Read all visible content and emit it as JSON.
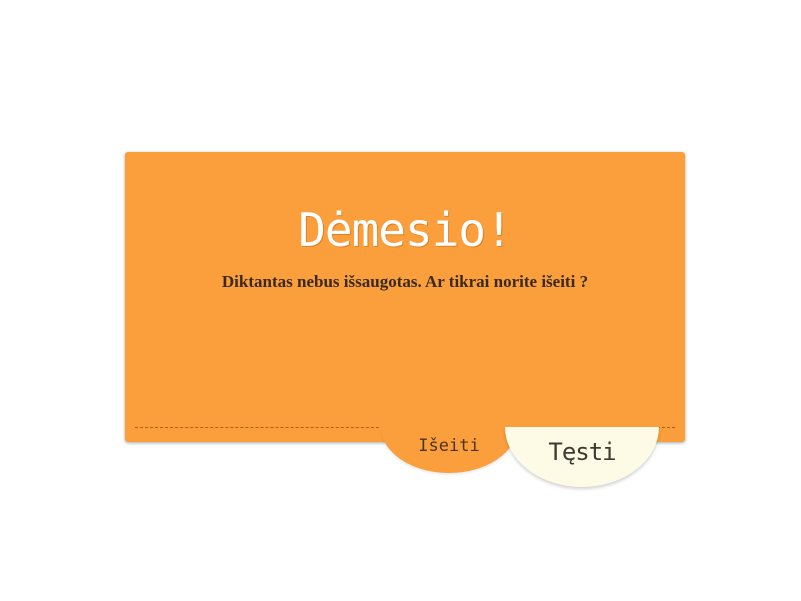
{
  "dialog": {
    "title": "Dėmesio!",
    "message": "Diktantas nebus išsaugotas. Ar tikrai norite išeiti ?",
    "exit_label": "Išeiti",
    "continue_label": "Tęsti"
  },
  "colors": {
    "dialog_background": "#fa9f3c",
    "continue_background": "#fdfbe6",
    "title_text": "#ffffff",
    "message_text": "#3a2a1e"
  }
}
